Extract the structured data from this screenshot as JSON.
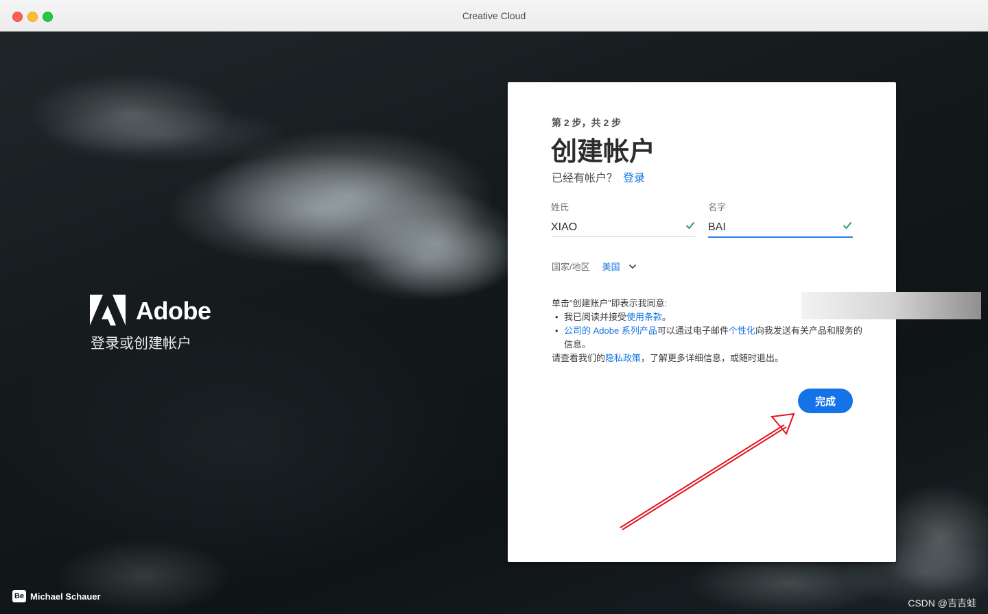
{
  "window": {
    "title": "Creative Cloud"
  },
  "brand": {
    "wordmark": "Adobe",
    "subtitle": "登录或创建帐户"
  },
  "photo_credit": {
    "badge": "Be",
    "name": "Michael Schauer"
  },
  "watermark": "CSDN @吉吉蛙",
  "form": {
    "step": "第 2 步，共 2 步",
    "heading": "创建帐户",
    "have_account": "已经有帐户？",
    "login_link": "登录",
    "last_name": {
      "label": "姓氏",
      "value": "XIAO"
    },
    "first_name": {
      "label": "名字",
      "value": "BAI"
    },
    "country": {
      "label": "国家/地区",
      "value": "美国"
    },
    "terms": {
      "intro": "单击“创建账户”即表示我同意:",
      "bullet1_prefix": "我已阅读并接受",
      "bullet1_link": "使用条款",
      "bullet1_suffix": "。",
      "bullet2_link1": "公司的 Adobe 系列产品",
      "bullet2_middle": "可以通过电子邮件",
      "bullet2_link2": "个性化",
      "bullet2_suffix": "向我发送有关产品和服务的信息。",
      "privacy_prefix": "请查看我们的",
      "privacy_link": "隐私政策",
      "privacy_suffix": "，了解更多详细信息，或随时退出。"
    },
    "submit_label": "完成"
  },
  "colors": {
    "accent": "#1473e6",
    "check": "#2d9d78",
    "annotation_arrow": "#e3121b"
  },
  "icons": {
    "field_valid": "check-icon",
    "country_dropdown": "chevron-down-icon",
    "brand_logo": "adobe-logo-icon"
  }
}
